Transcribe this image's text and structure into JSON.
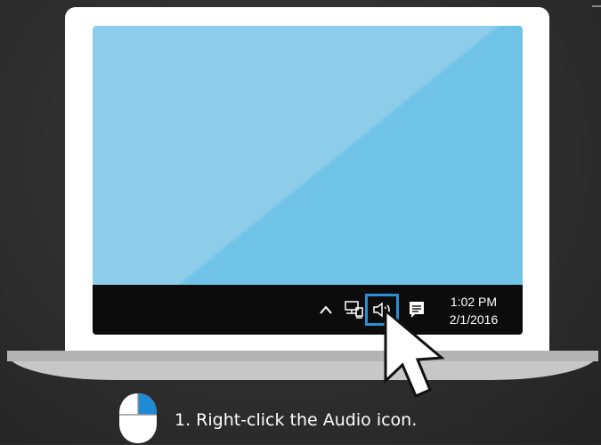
{
  "taskbar": {
    "clock": {
      "time": "1:02 PM",
      "date": "2/1/2016"
    },
    "tray_icons": [
      "chevron-up-icon",
      "network-icon",
      "speaker-icon",
      "notification-icon"
    ],
    "highlight_color": "#2b8fd6"
  },
  "colors": {
    "wallpaper_light": "#8ecdea",
    "wallpaper_dark": "#6fc3e6",
    "taskbar": "#0c0c0d",
    "mouse_button_accent": "#1f8ad4"
  },
  "instruction": {
    "text": "1. Right-click the Audio icon."
  }
}
